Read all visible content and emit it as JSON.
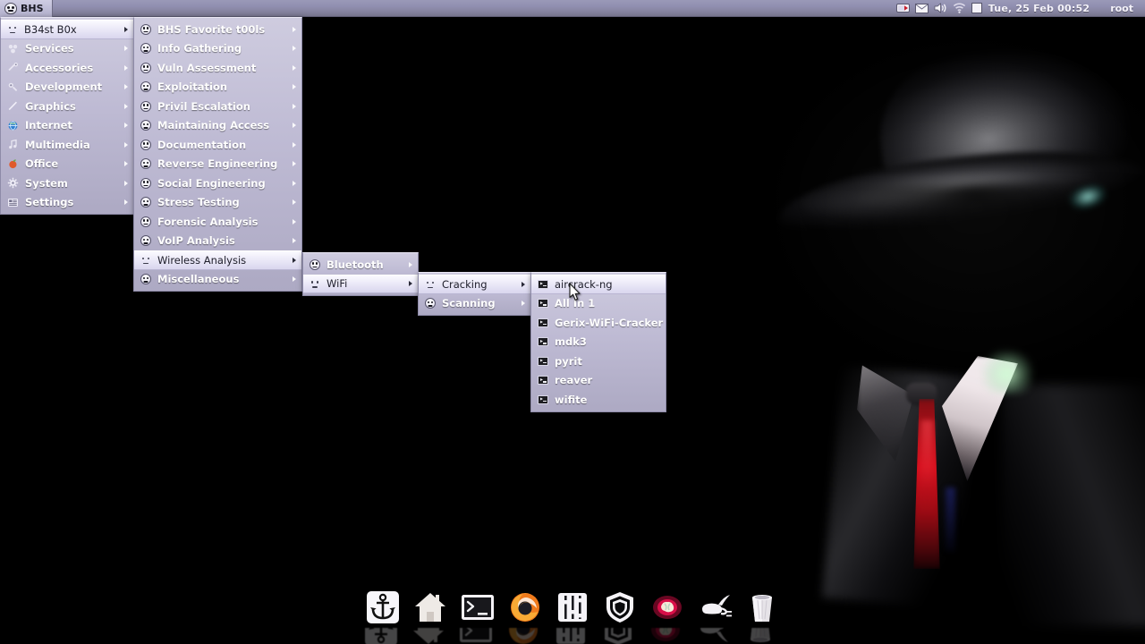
{
  "topbar": {
    "menu_button_label": "BHS",
    "menu_button_icon": "skull-icon",
    "tray_icons": [
      "network-icon",
      "mail-icon",
      "volume-icon",
      "wifi-icon",
      "window-icon"
    ],
    "clock": "Tue, 25 Feb  00:52",
    "user": "root"
  },
  "menus": {
    "root": {
      "name": "applications-menu",
      "items": [
        {
          "label": "B34st B0x",
          "icon": "skull-icon",
          "arrow": true,
          "highlighted": true
        },
        {
          "label": "Services",
          "icon": "services-icon",
          "arrow": true,
          "highlighted": false
        },
        {
          "label": "Accessories",
          "icon": "accessories-icon",
          "arrow": true,
          "highlighted": false
        },
        {
          "label": "Development",
          "icon": "development-icon",
          "arrow": true,
          "highlighted": false
        },
        {
          "label": "Graphics",
          "icon": "graphics-icon",
          "arrow": true,
          "highlighted": false
        },
        {
          "label": "Internet",
          "icon": "internet-icon",
          "arrow": true,
          "highlighted": false
        },
        {
          "label": "Multimedia",
          "icon": "multimedia-icon",
          "arrow": true,
          "highlighted": false
        },
        {
          "label": "Office",
          "icon": "office-icon",
          "arrow": true,
          "highlighted": false
        },
        {
          "label": "System",
          "icon": "system-icon",
          "arrow": true,
          "highlighted": false
        },
        {
          "label": "Settings",
          "icon": "settings-icon",
          "arrow": true,
          "highlighted": false
        }
      ]
    },
    "beast_box": {
      "name": "b34st-b0x-submenu",
      "items": [
        {
          "label": "BHS Favorite t00ls",
          "icon": "skull-icon",
          "arrow": true,
          "highlighted": false
        },
        {
          "label": "Info Gathering",
          "icon": "skull-icon",
          "arrow": true,
          "highlighted": false
        },
        {
          "label": "Vuln Assessment",
          "icon": "skull-icon",
          "arrow": true,
          "highlighted": false
        },
        {
          "label": "Exploitation",
          "icon": "skull-icon",
          "arrow": true,
          "highlighted": false
        },
        {
          "label": "Privil Escalation",
          "icon": "skull-icon",
          "arrow": true,
          "highlighted": false
        },
        {
          "label": "Maintaining Access",
          "icon": "skull-icon",
          "arrow": true,
          "highlighted": false
        },
        {
          "label": "Documentation",
          "icon": "skull-icon",
          "arrow": true,
          "highlighted": false
        },
        {
          "label": "Reverse Engineering",
          "icon": "skull-icon",
          "arrow": true,
          "highlighted": false
        },
        {
          "label": "Social Engineering",
          "icon": "skull-icon",
          "arrow": true,
          "highlighted": false
        },
        {
          "label": "Stress Testing",
          "icon": "skull-icon",
          "arrow": true,
          "highlighted": false
        },
        {
          "label": "Forensic Analysis",
          "icon": "skull-icon",
          "arrow": true,
          "highlighted": false
        },
        {
          "label": "VoIP Analysis",
          "icon": "skull-icon",
          "arrow": true,
          "highlighted": false
        },
        {
          "label": "Wireless Analysis",
          "icon": "skull-icon",
          "arrow": true,
          "highlighted": true
        },
        {
          "label": "Miscellaneous",
          "icon": "skull-icon",
          "arrow": true,
          "highlighted": false
        }
      ]
    },
    "wireless": {
      "name": "wireless-analysis-submenu",
      "items": [
        {
          "label": "Bluetooth",
          "icon": "skull-icon",
          "arrow": true,
          "highlighted": false
        },
        {
          "label": "WiFi",
          "icon": "skull-icon",
          "arrow": true,
          "highlighted": true
        }
      ]
    },
    "wifi": {
      "name": "wifi-submenu",
      "items": [
        {
          "label": "Cracking",
          "icon": "skull-icon",
          "arrow": true,
          "highlighted": true
        },
        {
          "label": "Scanning",
          "icon": "skull-icon",
          "arrow": true,
          "highlighted": false
        }
      ]
    },
    "cracking": {
      "name": "cracking-submenu",
      "items": [
        {
          "label": "aircrack-ng",
          "icon": "terminal-icon",
          "arrow": false,
          "highlighted": true
        },
        {
          "label": "All In 1",
          "icon": "terminal-icon",
          "arrow": false,
          "highlighted": false
        },
        {
          "label": "Gerix-WiFi-Cracker",
          "icon": "terminal-icon",
          "arrow": false,
          "highlighted": false
        },
        {
          "label": "mdk3",
          "icon": "terminal-icon",
          "arrow": false,
          "highlighted": false
        },
        {
          "label": "pyrit",
          "icon": "terminal-icon",
          "arrow": false,
          "highlighted": false
        },
        {
          "label": "reaver",
          "icon": "terminal-icon",
          "arrow": false,
          "highlighted": false
        },
        {
          "label": "wifite",
          "icon": "terminal-icon",
          "arrow": false,
          "highlighted": false
        }
      ]
    }
  },
  "dock": {
    "name": "desktop-dock",
    "items": [
      {
        "name": "anchor-icon",
        "title": "Anchor"
      },
      {
        "name": "home-icon",
        "title": "Home"
      },
      {
        "name": "terminal-icon",
        "title": "Terminal"
      },
      {
        "name": "firefox-icon",
        "title": "Firefox"
      },
      {
        "name": "mixer-icon",
        "title": "Mixer"
      },
      {
        "name": "shield-icon",
        "title": "Firewall"
      },
      {
        "name": "brain-icon",
        "title": "Brain"
      },
      {
        "name": "lamp-icon",
        "title": "Genie Lamp"
      },
      {
        "name": "trash-icon",
        "title": "Trash"
      }
    ]
  },
  "colors": {
    "panel_top": "#9a99b8",
    "menu_bg": "#cdc9e4",
    "menu_highlight": "#f4f2ff",
    "desktop_bg": "#000000",
    "accent_tie": "#d8101e"
  }
}
